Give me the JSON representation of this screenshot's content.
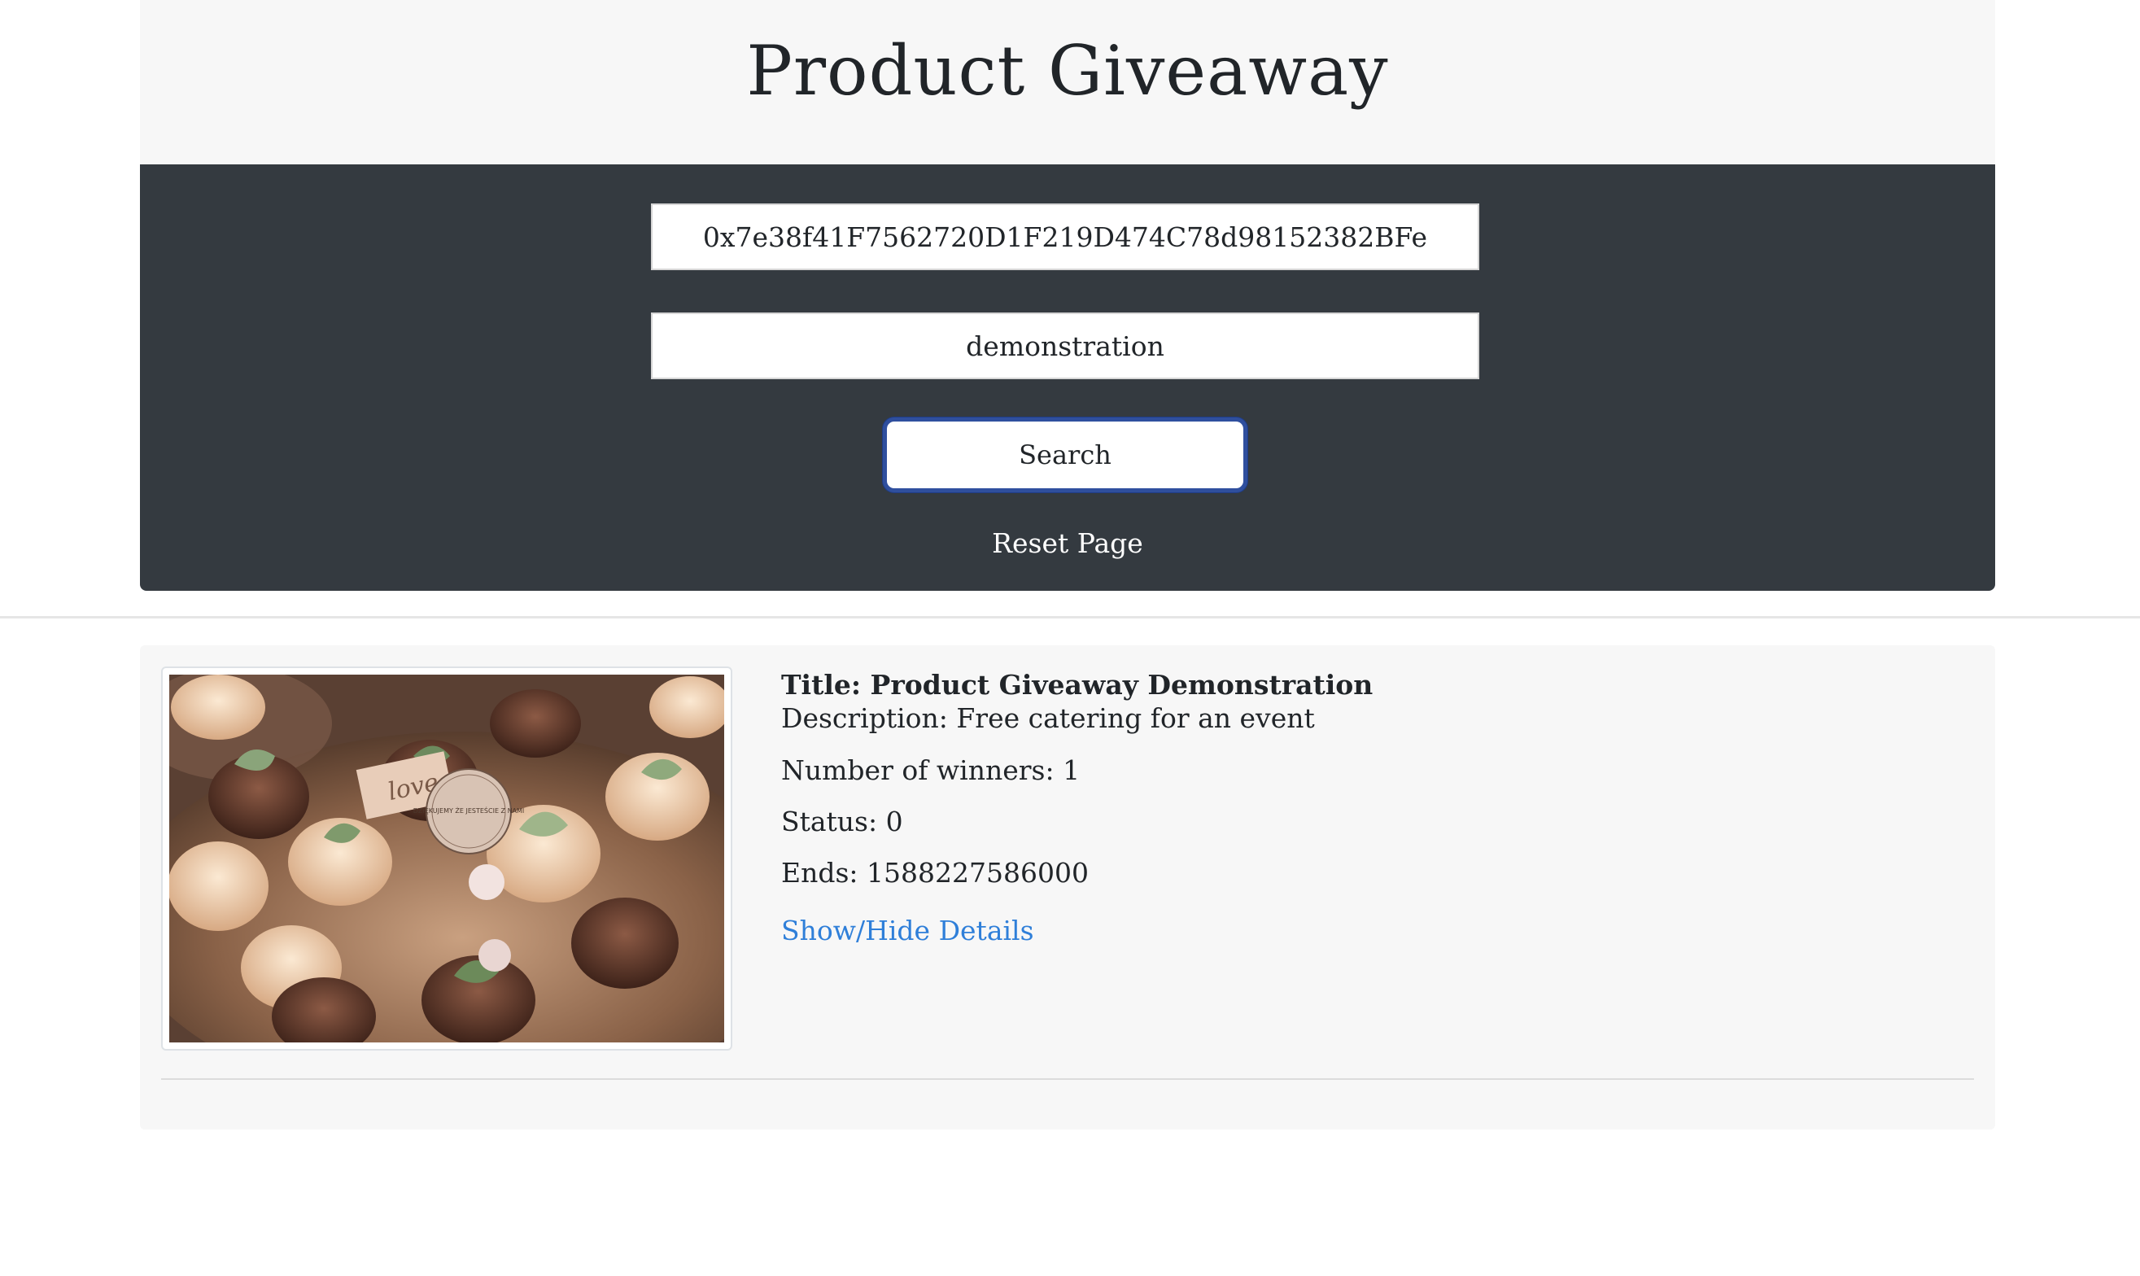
{
  "header": {
    "title": "Product Giveaway"
  },
  "search": {
    "address_value": "0x7e38f41F7562720D1F219D474C78d98152382BFe",
    "query_value": "demonstration",
    "search_label": "Search",
    "reset_label": "Reset Page"
  },
  "result": {
    "title": "Title: Product Giveaway Demonstration",
    "description": "Description: Free catering for an event",
    "winners": "Number of winners: 1",
    "status": "Status: 0",
    "ends": "Ends: 1588227586000",
    "details_link": "Show/Hide Details",
    "love_tag": "love",
    "badge_text": "DZIĘKUJEMY ŻE JESTEŚCIE Z NAMI"
  },
  "colors": {
    "search_panel_bg": "#343a40",
    "header_bg": "#f7f7f7",
    "link_blue": "#2f7fd9",
    "button_focus": "#2f4f9e"
  }
}
